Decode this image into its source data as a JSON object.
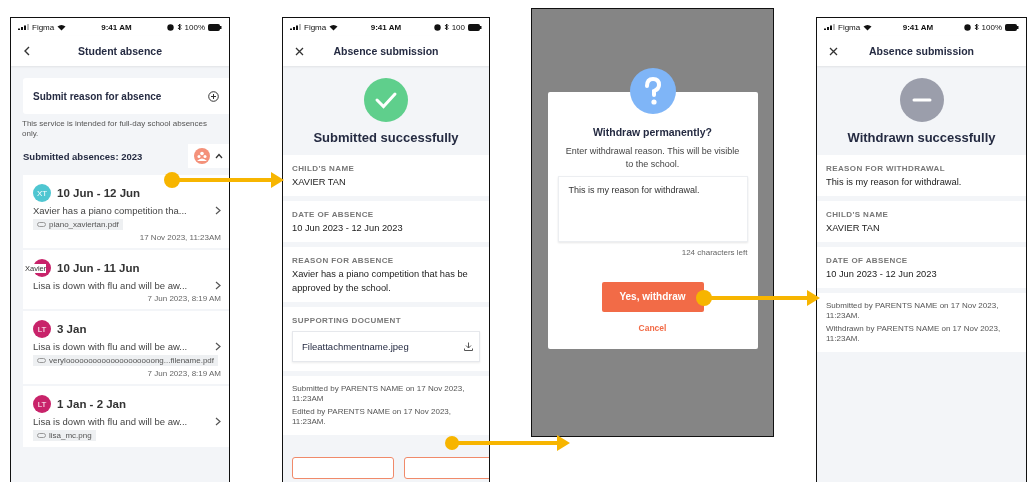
{
  "absence_list": {
    "status_bar": {
      "carrier": "Figma",
      "time": "9:41 AM",
      "battery": "100%"
    },
    "title": "Student absence",
    "submit_card": "Submit reason for absence",
    "note": "This service is intended for full-day school absences only.",
    "section_title": "Submitted absences: 2023",
    "expanded": true,
    "items": [
      {
        "initials": "XT",
        "color": "#4fc6d1",
        "dates": "10 Jun - 12 Jun",
        "reason": "Xavier has a piano competition tha...",
        "attachment": "piano_xaviertan.pdf",
        "timestamp": "17 Nov 2023, 11:23AM"
      },
      {
        "avatar_label": "Xavier",
        "color": "#c8236a",
        "dates": "10 Jun - 11 Jun",
        "reason": "Lisa is down with flu and will be aw...",
        "timestamp": "7 Jun 2023, 8:19 AM"
      },
      {
        "initials": "LT",
        "color": "#c8236a",
        "dates": "3 Jan",
        "reason": "Lisa is down with flu and will be aw...",
        "attachment": "veryloooooooooooooooooooong...filename.pdf",
        "timestamp": "7 Jun 2023, 8:19 AM"
      },
      {
        "initials": "LT",
        "color": "#c8236a",
        "dates": "1 Jan - 2 Jan",
        "reason": "Lisa is down with flu and will be aw...",
        "attachment": "lisa_mc.png"
      }
    ]
  },
  "submission_success": {
    "status_bar": {
      "carrier": "Figma",
      "time": "9:41 AM",
      "battery": "100"
    },
    "title": "Absence submission",
    "heading": "Submitted successfully",
    "fields": [
      {
        "label": "CHILD'S NAME",
        "lines": [
          "XAVIER TAN"
        ]
      },
      {
        "label": "DATE OF ABSENCE",
        "lines": [
          "10 Jun 2023 - 12 Jun 2023"
        ]
      },
      {
        "label": "REASON FOR ABSENCE",
        "lines": [
          "Xavier has a piano competition that has be",
          "approved by the school."
        ]
      }
    ],
    "document": {
      "label": "SUPPORTING DOCUMENT",
      "file": "Fileattachmentname.jpeg"
    },
    "footer": [
      "Submitted by PARENTS NAME on 17 Nov 2023, 11:23AM",
      "Edited by PARENTS NAME on 17 Nov 2023, 11:23AM."
    ]
  },
  "withdraw_dialog": {
    "title": "Withdraw permanently?",
    "message": "Enter withdrawal reason. This will be visible to the school.",
    "input_value": "This is my reason for withdrawal.",
    "counter": "124 characters left",
    "confirm": "Yes, withdraw",
    "cancel": "Cancel"
  },
  "withdrawal_success": {
    "status_bar": {
      "carrier": "Figma",
      "time": "9:41 AM",
      "battery": "100%"
    },
    "title": "Absence submission",
    "heading": "Withdrawn successfully",
    "fields": [
      {
        "label": "REASON FOR WITHDRAWAL",
        "lines": [
          "This is my reason for withdrawal."
        ]
      },
      {
        "label": "CHILD'S NAME",
        "lines": [
          "XAVIER TAN"
        ]
      },
      {
        "label": "DATE OF ABSENCE",
        "lines": [
          "10 Jun 2023 - 12 Jun 2023"
        ]
      }
    ],
    "footer": [
      "Submitted by PARENTS NAME on 17 Nov 2023, 11:23AM.",
      "Withdrawn by PARENTS NAME on 17 Nov 2023, 11:23AM."
    ]
  }
}
